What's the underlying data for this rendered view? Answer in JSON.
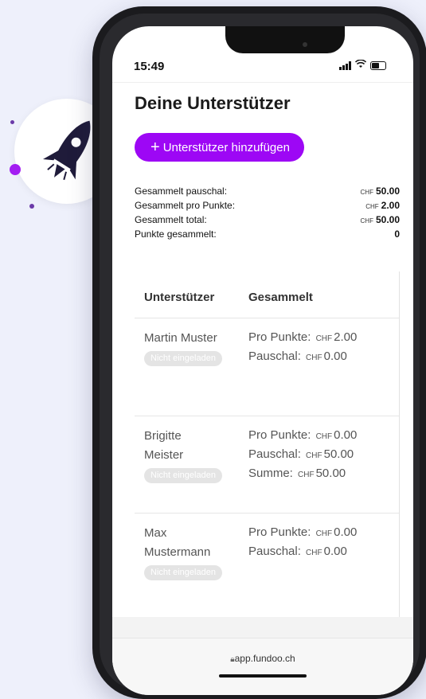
{
  "status_bar": {
    "time": "15:49"
  },
  "page": {
    "title": "Deine Unterstützer",
    "add_button": {
      "label": "Unterstützer hinzufügen"
    }
  },
  "summary": {
    "currency": "CHF",
    "rows": [
      {
        "label": "Gesammelt pauschal:",
        "value": "50.00",
        "currency": "CHF"
      },
      {
        "label": "Gesammelt pro Punkte:",
        "value": "2.00",
        "currency": "CHF"
      },
      {
        "label": "Gesammelt total:",
        "value": "50.00",
        "currency": "CHF"
      },
      {
        "label": "Punkte gesammelt:",
        "value": "0",
        "currency": ""
      }
    ]
  },
  "table": {
    "headers": [
      "Unterstützer",
      "Gesammelt"
    ],
    "rows": [
      {
        "name": "Martin Muster",
        "status": "Nicht eingeladen",
        "amounts": [
          {
            "label": "Pro Punkte:",
            "currency": "CHF",
            "value": "2.00"
          },
          {
            "label": "Pauschal:",
            "currency": "CHF",
            "value": "0.00"
          }
        ]
      },
      {
        "name": "Brigitte Meister",
        "status": "Nicht eingeladen",
        "amounts": [
          {
            "label": "Pro Punkte:",
            "currency": "CHF",
            "value": "0.00"
          },
          {
            "label": "Pauschal:",
            "currency": "CHF",
            "value": "50.00"
          },
          {
            "label": "Summe:",
            "currency": "CHF",
            "value": "50.00"
          }
        ]
      },
      {
        "name": "Max Mustermann",
        "status": "Nicht eingeladen",
        "amounts": [
          {
            "label": "Pro Punkte:",
            "currency": "CHF",
            "value": "0.00"
          },
          {
            "label": "Pauschal:",
            "currency": "CHF",
            "value": "0.00"
          }
        ]
      }
    ]
  },
  "browser": {
    "url": "app.fundoo.ch"
  },
  "colors": {
    "accent": "#9d07f5",
    "rocket": "#1f1b3a",
    "dots": "#7b3fc4"
  },
  "icons": {
    "badge": "rocket-icon",
    "url": "lock-icon"
  }
}
